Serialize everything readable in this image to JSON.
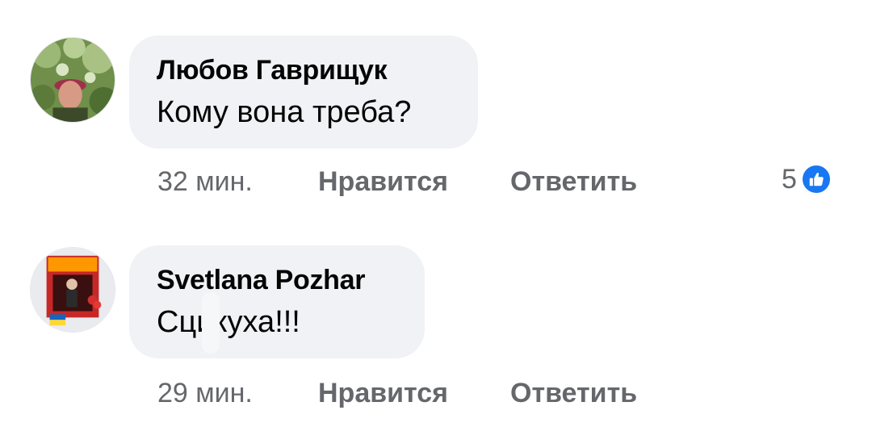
{
  "comments": [
    {
      "author": "Любов Гаврищук",
      "text": "Кому вона треба?",
      "time": "32 мин.",
      "like_label": "Нравится",
      "reply_label": "Ответить",
      "reaction_count": "5",
      "reaction_icon": "thumbs-up-icon",
      "avatar_icon": "profile-photo"
    },
    {
      "author": "Svetlana Pozhar",
      "text": "Сцикуха!!!",
      "time": "29 мин.",
      "like_label": "Нравится",
      "reply_label": "Ответить",
      "avatar_icon": "profile-photo"
    }
  ],
  "colors": {
    "bubble": "#f0f2f5",
    "meta_text": "#65676b",
    "like_blue": "#1877f2"
  }
}
